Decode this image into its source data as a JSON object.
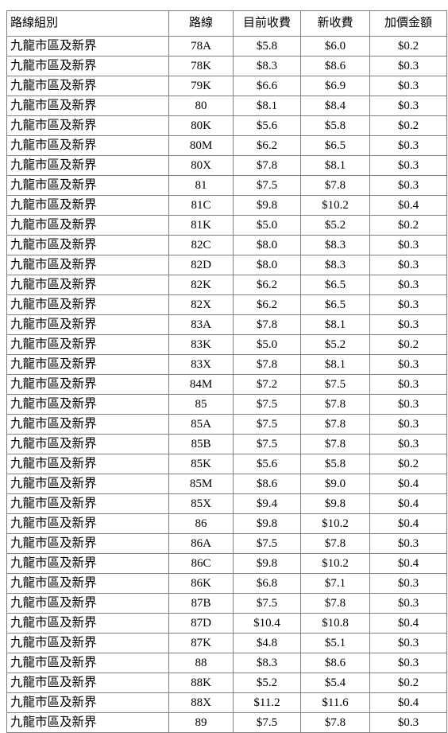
{
  "table": {
    "columns": [
      {
        "key": "group",
        "label": "路線組別",
        "align": "left"
      },
      {
        "key": "route",
        "label": "路線",
        "align": "center"
      },
      {
        "key": "current_fare",
        "label": "目前收費",
        "align": "center"
      },
      {
        "key": "new_fare",
        "label": "新收費",
        "align": "center"
      },
      {
        "key": "increase",
        "label": "加價金額",
        "align": "center"
      }
    ],
    "rows": [
      {
        "group": "九龍市區及新界",
        "route": "78A",
        "current_fare": "$5.8",
        "new_fare": "$6.0",
        "increase": "$0.2"
      },
      {
        "group": "九龍市區及新界",
        "route": "78K",
        "current_fare": "$8.3",
        "new_fare": "$8.6",
        "increase": "$0.3"
      },
      {
        "group": "九龍市區及新界",
        "route": "79K",
        "current_fare": "$6.6",
        "new_fare": "$6.9",
        "increase": "$0.3"
      },
      {
        "group": "九龍市區及新界",
        "route": "80",
        "current_fare": "$8.1",
        "new_fare": "$8.4",
        "increase": "$0.3"
      },
      {
        "group": "九龍市區及新界",
        "route": "80K",
        "current_fare": "$5.6",
        "new_fare": "$5.8",
        "increase": "$0.2"
      },
      {
        "group": "九龍市區及新界",
        "route": "80M",
        "current_fare": "$6.2",
        "new_fare": "$6.5",
        "increase": "$0.3"
      },
      {
        "group": "九龍市區及新界",
        "route": "80X",
        "current_fare": "$7.8",
        "new_fare": "$8.1",
        "increase": "$0.3"
      },
      {
        "group": "九龍市區及新界",
        "route": "81",
        "current_fare": "$7.5",
        "new_fare": "$7.8",
        "increase": "$0.3"
      },
      {
        "group": "九龍市區及新界",
        "route": "81C",
        "current_fare": "$9.8",
        "new_fare": "$10.2",
        "increase": "$0.4"
      },
      {
        "group": "九龍市區及新界",
        "route": "81K",
        "current_fare": "$5.0",
        "new_fare": "$5.2",
        "increase": "$0.2"
      },
      {
        "group": "九龍市區及新界",
        "route": "82C",
        "current_fare": "$8.0",
        "new_fare": "$8.3",
        "increase": "$0.3"
      },
      {
        "group": "九龍市區及新界",
        "route": "82D",
        "current_fare": "$8.0",
        "new_fare": "$8.3",
        "increase": "$0.3"
      },
      {
        "group": "九龍市區及新界",
        "route": "82K",
        "current_fare": "$6.2",
        "new_fare": "$6.5",
        "increase": "$0.3"
      },
      {
        "group": "九龍市區及新界",
        "route": "82X",
        "current_fare": "$6.2",
        "new_fare": "$6.5",
        "increase": "$0.3"
      },
      {
        "group": "九龍市區及新界",
        "route": "83A",
        "current_fare": "$7.8",
        "new_fare": "$8.1",
        "increase": "$0.3"
      },
      {
        "group": "九龍市區及新界",
        "route": "83K",
        "current_fare": "$5.0",
        "new_fare": "$5.2",
        "increase": "$0.2"
      },
      {
        "group": "九龍市區及新界",
        "route": "83X",
        "current_fare": "$7.8",
        "new_fare": "$8.1",
        "increase": "$0.3"
      },
      {
        "group": "九龍市區及新界",
        "route": "84M",
        "current_fare": "$7.2",
        "new_fare": "$7.5",
        "increase": "$0.3"
      },
      {
        "group": "九龍市區及新界",
        "route": "85",
        "current_fare": "$7.5",
        "new_fare": "$7.8",
        "increase": "$0.3"
      },
      {
        "group": "九龍市區及新界",
        "route": "85A",
        "current_fare": "$7.5",
        "new_fare": "$7.8",
        "increase": "$0.3"
      },
      {
        "group": "九龍市區及新界",
        "route": "85B",
        "current_fare": "$7.5",
        "new_fare": "$7.8",
        "increase": "$0.3"
      },
      {
        "group": "九龍市區及新界",
        "route": "85K",
        "current_fare": "$5.6",
        "new_fare": "$5.8",
        "increase": "$0.2"
      },
      {
        "group": "九龍市區及新界",
        "route": "85M",
        "current_fare": "$8.6",
        "new_fare": "$9.0",
        "increase": "$0.4"
      },
      {
        "group": "九龍市區及新界",
        "route": "85X",
        "current_fare": "$9.4",
        "new_fare": "$9.8",
        "increase": "$0.4"
      },
      {
        "group": "九龍市區及新界",
        "route": "86",
        "current_fare": "$9.8",
        "new_fare": "$10.2",
        "increase": "$0.4"
      },
      {
        "group": "九龍市區及新界",
        "route": "86A",
        "current_fare": "$7.5",
        "new_fare": "$7.8",
        "increase": "$0.3"
      },
      {
        "group": "九龍市區及新界",
        "route": "86C",
        "current_fare": "$9.8",
        "new_fare": "$10.2",
        "increase": "$0.4"
      },
      {
        "group": "九龍市區及新界",
        "route": "86K",
        "current_fare": "$6.8",
        "new_fare": "$7.1",
        "increase": "$0.3"
      },
      {
        "group": "九龍市區及新界",
        "route": "87B",
        "current_fare": "$7.5",
        "new_fare": "$7.8",
        "increase": "$0.3"
      },
      {
        "group": "九龍市區及新界",
        "route": "87D",
        "current_fare": "$10.4",
        "new_fare": "$10.8",
        "increase": "$0.4"
      },
      {
        "group": "九龍市區及新界",
        "route": "87K",
        "current_fare": "$4.8",
        "new_fare": "$5.1",
        "increase": "$0.3"
      },
      {
        "group": "九龍市區及新界",
        "route": "88",
        "current_fare": "$8.3",
        "new_fare": "$8.6",
        "increase": "$0.3"
      },
      {
        "group": "九龍市區及新界",
        "route": "88K",
        "current_fare": "$5.2",
        "new_fare": "$5.4",
        "increase": "$0.2"
      },
      {
        "group": "九龍市區及新界",
        "route": "88X",
        "current_fare": "$11.2",
        "new_fare": "$11.6",
        "increase": "$0.4"
      },
      {
        "group": "九龍市區及新界",
        "route": "89",
        "current_fare": "$7.5",
        "new_fare": "$7.8",
        "increase": "$0.3"
      }
    ]
  },
  "style": {
    "border_color": "#808080",
    "background": "#ffffff",
    "text_color": "#000000"
  }
}
